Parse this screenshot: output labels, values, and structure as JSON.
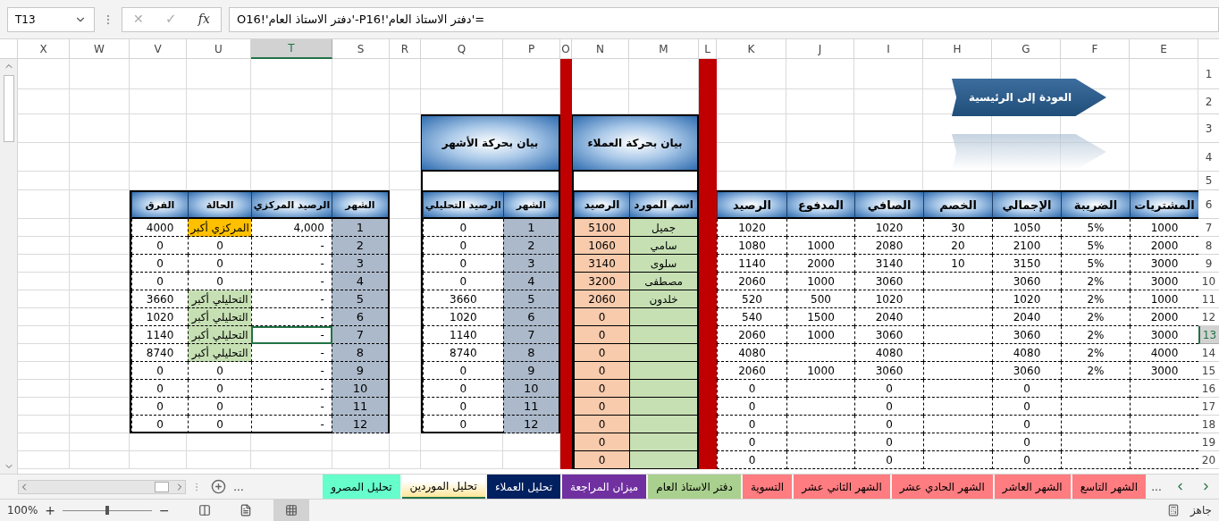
{
  "formula_bar": {
    "name_box": "T13",
    "cancel": "✕",
    "enter": "✓",
    "function": "fx",
    "formula": "='دفتر الاستاذ العام'!P16-'دفتر الاستاذ العام'!O16"
  },
  "columns": [
    {
      "label": "E",
      "selected": false
    },
    {
      "label": "F",
      "selected": false
    },
    {
      "label": "G",
      "selected": false
    },
    {
      "label": "H",
      "selected": false
    },
    {
      "label": "I",
      "selected": false
    },
    {
      "label": "J",
      "selected": false
    },
    {
      "label": "K",
      "selected": false
    },
    {
      "label": "L",
      "selected": false
    },
    {
      "label": "M",
      "selected": false
    },
    {
      "label": "N",
      "selected": false
    },
    {
      "label": "O",
      "selected": false
    },
    {
      "label": "P",
      "selected": false
    },
    {
      "label": "Q",
      "selected": false
    },
    {
      "label": "R",
      "selected": false
    },
    {
      "label": "S",
      "selected": false
    },
    {
      "label": "T",
      "selected": true
    },
    {
      "label": "U",
      "selected": false
    },
    {
      "label": "V",
      "selected": false
    },
    {
      "label": "W",
      "selected": false
    },
    {
      "label": "X",
      "selected": false
    }
  ],
  "rows": [
    {
      "label": "1",
      "selected": false
    },
    {
      "label": "2",
      "selected": false
    },
    {
      "label": "3",
      "selected": false
    },
    {
      "label": "4",
      "selected": false
    },
    {
      "label": "5",
      "selected": false
    },
    {
      "label": "6",
      "selected": false
    },
    {
      "label": "7",
      "selected": false
    },
    {
      "label": "8",
      "selected": false
    },
    {
      "label": "9",
      "selected": false
    },
    {
      "label": "10",
      "selected": false
    },
    {
      "label": "11",
      "selected": false
    },
    {
      "label": "12",
      "selected": false
    },
    {
      "label": "13",
      "selected": true
    },
    {
      "label": "14",
      "selected": false
    },
    {
      "label": "15",
      "selected": false
    },
    {
      "label": "16",
      "selected": false
    },
    {
      "label": "17",
      "selected": false
    },
    {
      "label": "18",
      "selected": false
    },
    {
      "label": "19",
      "selected": false
    },
    {
      "label": "20",
      "selected": false
    }
  ],
  "back_button": {
    "label": "العودة إلى الرئيسية"
  },
  "ledger": {
    "columns": [
      "المشتريات",
      "الضريبة",
      "الإجمالي",
      "الخصم",
      "الصافي",
      "المدفوع",
      "الرصيد"
    ],
    "rows": [
      [
        "1000",
        "5%",
        "1050",
        "30",
        "1020",
        null,
        "1020"
      ],
      [
        "2000",
        "5%",
        "2100",
        "20",
        "2080",
        "1000",
        "1080"
      ],
      [
        "3000",
        "5%",
        "3150",
        "10",
        "3140",
        "2000",
        "1140"
      ],
      [
        "3000",
        "2%",
        "3060",
        null,
        "3060",
        "1000",
        "2060"
      ],
      [
        "1000",
        "2%",
        "1020",
        null,
        "1020",
        "500",
        "520"
      ],
      [
        "2000",
        "2%",
        "2040",
        null,
        "2040",
        "1500",
        "540"
      ],
      [
        "3000",
        "2%",
        "3060",
        null,
        "3060",
        "1000",
        "2060"
      ],
      [
        "4000",
        "2%",
        "4080",
        null,
        "4080",
        null,
        "4080"
      ],
      [
        "3000",
        "2%",
        "3060",
        null,
        "3060",
        "1000",
        "2060"
      ],
      [
        null,
        null,
        "0",
        null,
        "0",
        null,
        "0"
      ],
      [
        null,
        null,
        "0",
        null,
        "0",
        null,
        "0"
      ],
      [
        null,
        null,
        "0",
        null,
        "0",
        null,
        "0"
      ],
      [
        null,
        null,
        "0",
        null,
        "0",
        null,
        "0"
      ],
      [
        null,
        null,
        "0",
        null,
        "0",
        null,
        "0"
      ]
    ]
  },
  "suppliers": {
    "title": "بيان بحركة العملاء",
    "columns": [
      "اسم المورد",
      "الرصيد"
    ],
    "rows": [
      [
        "جميل",
        "5100"
      ],
      [
        "سامي",
        "1060"
      ],
      [
        "سلوى",
        "3140"
      ],
      [
        "مصطفى",
        "3200"
      ],
      [
        "خلدون",
        "2060"
      ],
      [
        null,
        "0"
      ],
      [
        null,
        "0"
      ],
      [
        null,
        "0"
      ],
      [
        null,
        "0"
      ],
      [
        null,
        "0"
      ],
      [
        null,
        "0"
      ],
      [
        null,
        "0"
      ],
      [
        null,
        "0"
      ],
      [
        null,
        "0"
      ]
    ]
  },
  "months": {
    "title": "بيان بحركة الأشهر",
    "columns": [
      "الشهر",
      "الرصيد التحليلي"
    ],
    "rows": [
      [
        "1",
        "0"
      ],
      [
        "2",
        "0"
      ],
      [
        "3",
        "0"
      ],
      [
        "4",
        "0"
      ],
      [
        "5",
        "3660"
      ],
      [
        "6",
        "1020"
      ],
      [
        "7",
        "1140"
      ],
      [
        "8",
        "8740"
      ],
      [
        "9",
        "0"
      ],
      [
        "10",
        "0"
      ],
      [
        "11",
        "0"
      ],
      [
        "12",
        "0"
      ]
    ]
  },
  "comparison": {
    "columns": [
      "الشهر",
      "الرصيد المركزي",
      "الحالة",
      "الفرق"
    ],
    "rows": [
      {
        "month": "1",
        "central": "4,000",
        "status": {
          "text": "المركزي أكبر",
          "color": "#ffc000"
        },
        "difference": "4000"
      },
      {
        "month": "2",
        "central": "-",
        "status": {
          "text": "0"
        },
        "difference": "0"
      },
      {
        "month": "3",
        "central": "-",
        "status": {
          "text": "0"
        },
        "difference": "0"
      },
      {
        "month": "4",
        "central": "-",
        "status": {
          "text": "0"
        },
        "difference": "0"
      },
      {
        "month": "5",
        "central": "-",
        "status": {
          "text": "التحليلي أكبر",
          "color": "#c6e0b4"
        },
        "difference": "3660"
      },
      {
        "month": "6",
        "central": "-",
        "status": {
          "text": "التحليلي أكبر",
          "color": "#c6e0b4"
        },
        "difference": "1020"
      },
      {
        "month": "7",
        "central": "-",
        "status": {
          "text": "التحليلي أكبر",
          "color": "#c6e0b4"
        },
        "difference": "1140"
      },
      {
        "month": "8",
        "central": "-",
        "status": {
          "text": "التحليلي أكبر",
          "color": "#c6e0b4"
        },
        "difference": "8740"
      },
      {
        "month": "9",
        "central": "-",
        "status": {
          "text": "0"
        },
        "difference": "0"
      },
      {
        "month": "10",
        "central": "-",
        "status": {
          "text": "0"
        },
        "difference": "0"
      },
      {
        "month": "11",
        "central": "-",
        "status": {
          "text": "0"
        },
        "difference": "0"
      },
      {
        "month": "12",
        "central": "-",
        "status": {
          "text": "0"
        },
        "difference": "0"
      }
    ]
  },
  "sheet_tabs": [
    {
      "label": "الشهر التاسع",
      "color": "#ff7c80",
      "selected": false
    },
    {
      "label": "الشهر العاشر",
      "color": "#ff7c80",
      "selected": false
    },
    {
      "label": "الشهر الحادي عشر",
      "color": "#ff7c80",
      "selected": false
    },
    {
      "label": "الشهر الثاني عشر",
      "color": "#ff7c80",
      "selected": false
    },
    {
      "label": "التسوية",
      "color": "#ff7c80",
      "selected": false
    },
    {
      "label": "دفتر الاستاذ العام",
      "color": "#a9d08e",
      "selected": false
    },
    {
      "label": "ميزان المراجعة",
      "color": "#7030a0",
      "selected": false
    },
    {
      "label": "تحليل العملاء",
      "color": "#002060",
      "selected": false
    },
    {
      "label": "تحليل الموردين",
      "color": "#ffe699",
      "selected": true
    },
    {
      "label": "تحليل المصرو",
      "color": "#66ffcc",
      "selected": false
    }
  ],
  "tab_more_right": "...",
  "tab_more_left": "...",
  "status_bar": {
    "status": "جاهز",
    "zoom": "100%",
    "zoom_in": "+",
    "zoom_out": "−",
    "zoom_slider": {
      "level": 0.5
    }
  }
}
